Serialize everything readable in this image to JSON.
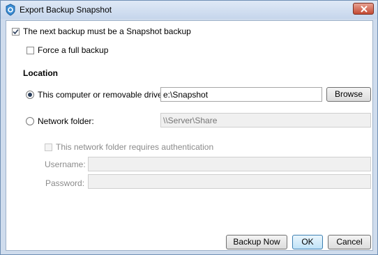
{
  "window": {
    "title": "Export Backup Snapshot"
  },
  "options": {
    "snapshot_label": "The next backup must be a Snapshot backup",
    "snapshot_checked": true,
    "full_label": "Force a full backup",
    "full_checked": false
  },
  "location": {
    "heading": "Location",
    "local_label": "This computer or removable drive:",
    "local_value": "e:\\Snapshot",
    "browse_label": "Browse",
    "network_label": "Network folder:",
    "network_placeholder": "\\\\Server\\Share",
    "auth_label": "This network folder requires authentication",
    "username_label": "Username:",
    "password_label": "Password:"
  },
  "buttons": {
    "backup_now": "Backup Now",
    "ok": "OK",
    "cancel": "Cancel"
  },
  "icons": {
    "app": "carbonite-logo-icon",
    "close": "close-icon",
    "check": "checkmark-icon"
  }
}
